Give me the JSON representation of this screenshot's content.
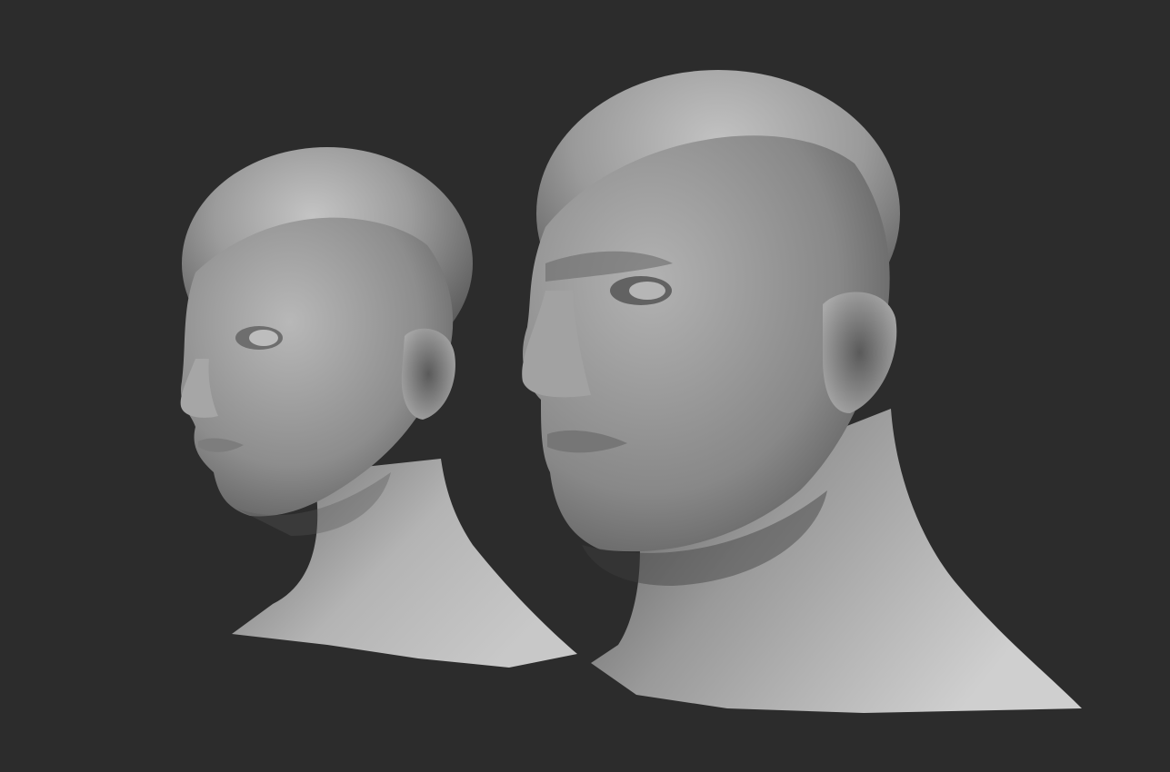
{
  "scene": {
    "background_color": "#2c2c2c",
    "material_color": "#9a9a9a",
    "models": [
      {
        "name": "female-head-bust",
        "description_visible": false
      },
      {
        "name": "male-head-bust",
        "description_visible": false
      }
    ]
  }
}
